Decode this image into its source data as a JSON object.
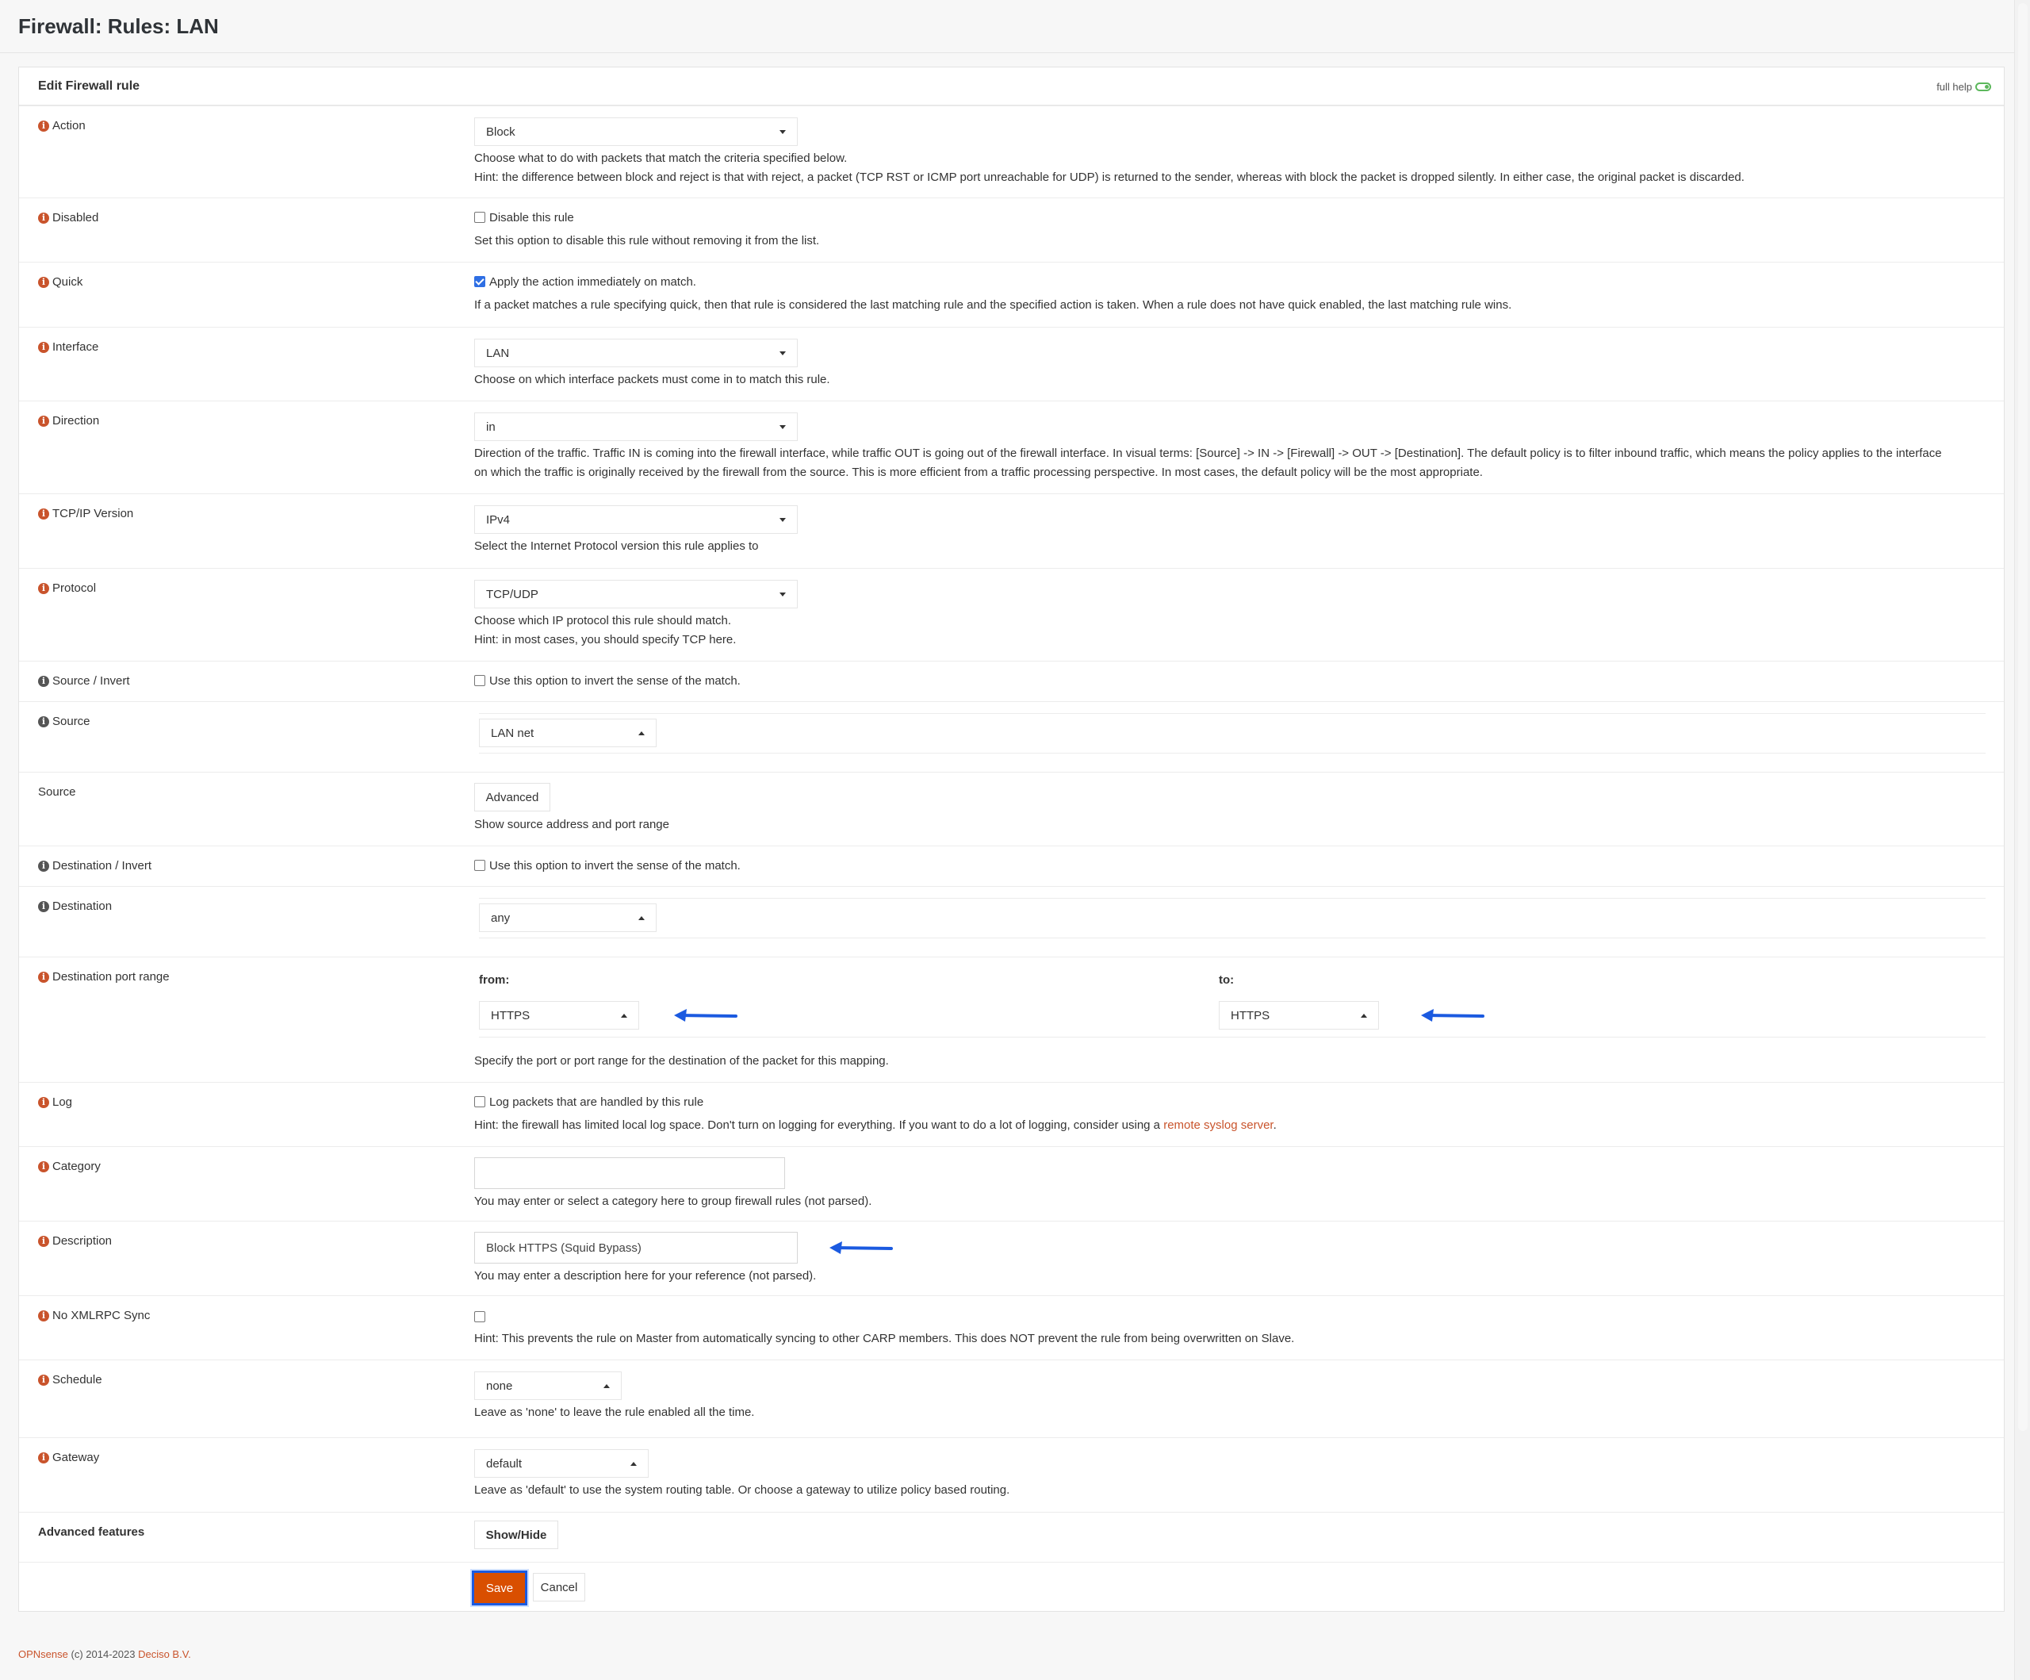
{
  "page_title": "Firewall: Rules: LAN",
  "panel": {
    "title": "Edit Firewall rule",
    "full_help": "full help"
  },
  "action": {
    "label": "Action",
    "value": "Block",
    "help1": "Choose what to do with packets that match the criteria specified below.",
    "help2": "Hint: the difference between block and reject is that with reject, a packet (TCP RST or ICMP port unreachable for UDP) is returned to the sender, whereas with block the packet is dropped silently. In either case, the original packet is discarded."
  },
  "disabled": {
    "label": "Disabled",
    "checked": false,
    "checkbox_label": "Disable this rule",
    "help": "Set this option to disable this rule without removing it from the list."
  },
  "quick": {
    "label": "Quick",
    "checked": true,
    "checkbox_label": "Apply the action immediately on match.",
    "help": "If a packet matches a rule specifying quick, then that rule is considered the last matching rule and the specified action is taken. When a rule does not have quick enabled, the last matching rule wins."
  },
  "interface": {
    "label": "Interface",
    "value": "LAN",
    "help": "Choose on which interface packets must come in to match this rule."
  },
  "direction": {
    "label": "Direction",
    "value": "in",
    "help1": "Direction of the traffic. Traffic IN is coming into the firewall interface, while traffic OUT is going out of the firewall interface. In visual terms: [Source] -> IN -> [Firewall] -> OUT -> [Destination]. The default policy is to filter inbound traffic, which means the policy applies to the interface",
    "help2": "on which the traffic is originally received by the firewall from the source. This is more efficient from a traffic processing perspective. In most cases, the default policy will be the most appropriate."
  },
  "tcpip": {
    "label": "TCP/IP Version",
    "value": "IPv4",
    "help": "Select the Internet Protocol version this rule applies to"
  },
  "protocol": {
    "label": "Protocol",
    "value": "TCP/UDP",
    "help1": "Choose which IP protocol this rule should match.",
    "help2": "Hint: in most cases, you should specify TCP here."
  },
  "source_invert": {
    "label": "Source / Invert",
    "checked": false,
    "checkbox_label": "Use this option to invert the sense of the match."
  },
  "source": {
    "label": "Source",
    "value": "LAN net"
  },
  "source_advanced": {
    "label": "Source",
    "button": "Advanced",
    "help": "Show source address and port range"
  },
  "destination_invert": {
    "label": "Destination / Invert",
    "checked": false,
    "checkbox_label": "Use this option to invert the sense of the match."
  },
  "destination": {
    "label": "Destination",
    "value": "any"
  },
  "dest_port": {
    "label": "Destination port range",
    "from_label": "from:",
    "from_value": "HTTPS",
    "to_label": "to:",
    "to_value": "HTTPS",
    "help": "Specify the port or port range for the destination of the packet for this mapping."
  },
  "log": {
    "label": "Log",
    "checked": false,
    "checkbox_label": "Log packets that are handled by this rule",
    "help_prefix": "Hint: the firewall has limited local log space. Don't turn on logging for everything. If you want to do a lot of logging, consider using a",
    "help_link": "remote syslog server",
    "help_suffix": "."
  },
  "category": {
    "label": "Category",
    "value": "",
    "help": "You may enter or select a category here to group firewall rules (not parsed)."
  },
  "description": {
    "label": "Description",
    "value": "Block HTTPS (Squid Bypass)",
    "help": "You may enter a description here for your reference (not parsed)."
  },
  "xmlrpc": {
    "label": "No XMLRPC Sync",
    "checked": false,
    "help": "Hint: This prevents the rule on Master from automatically syncing to other CARP members. This does NOT prevent the rule from being overwritten on Slave."
  },
  "schedule": {
    "label": "Schedule",
    "value": "none",
    "help": "Leave as 'none' to leave the rule enabled all the time."
  },
  "gateway": {
    "label": "Gateway",
    "value": "default",
    "help": "Leave as 'default' to use the system routing table. Or choose a gateway to utilize policy based routing."
  },
  "advanced_features": {
    "label": "Advanced features",
    "button": "Show/Hide"
  },
  "buttons": {
    "save": "Save",
    "cancel": "Cancel"
  },
  "footer": {
    "brand": "OPNsense",
    "copyright": "(c) 2014-2023",
    "company": "Deciso B.V."
  },
  "colors": {
    "accent": "#d94f00",
    "info_icon": "#c9542c",
    "annotation_arrow": "#1b5ae0"
  }
}
